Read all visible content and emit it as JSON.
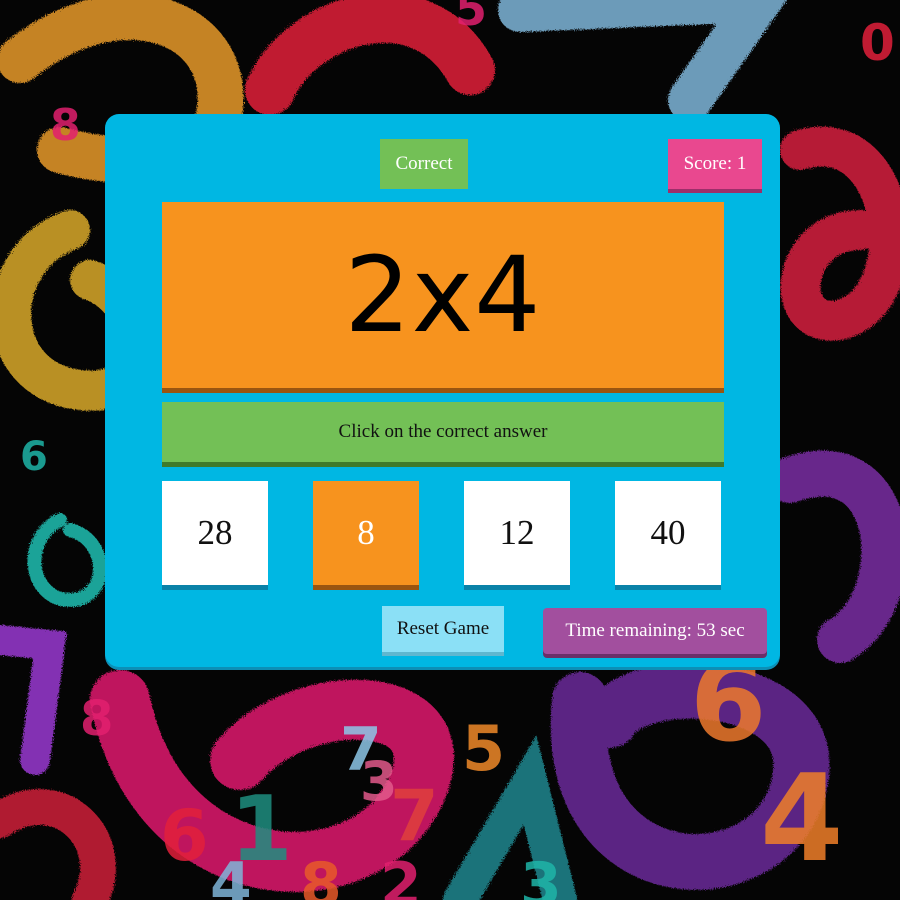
{
  "game": {
    "status": "Correct",
    "score": "Score: 1",
    "question": "2x4",
    "instruction": "Click on the correct answer",
    "choices": [
      "28",
      "8",
      "12",
      "40"
    ],
    "selected_choice_index": 1,
    "reset_label": "Reset Game",
    "time_remaining": "Time remaining: 53 sec"
  },
  "background": {
    "digits": [
      "8",
      "5",
      "8",
      "6",
      "7",
      "3",
      "5",
      "7",
      "4",
      "6",
      "1",
      "4",
      "8",
      "2",
      "3",
      "6",
      "0"
    ]
  },
  "colors": {
    "panel": "#00b7e3",
    "status_green": "#73c056",
    "score_pink": "#e9488f",
    "question_orange": "#f7931e",
    "reset_light_blue": "#8be0f6",
    "timer_purple": "#a24f9e"
  }
}
